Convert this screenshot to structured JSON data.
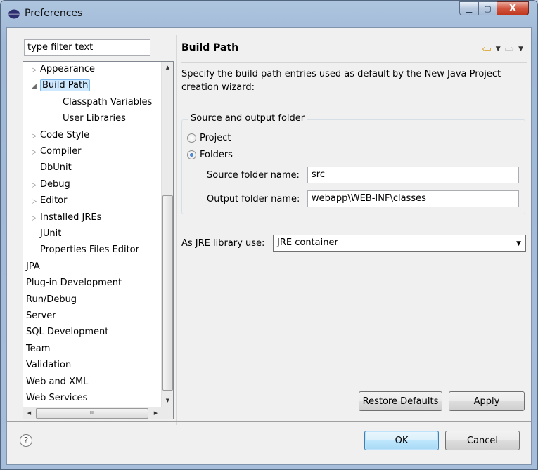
{
  "window": {
    "title": "Preferences",
    "controls": {
      "minimize": "▁",
      "maximize": "▢",
      "close": "X"
    }
  },
  "left": {
    "filter_placeholder": "type filter text",
    "tree": [
      {
        "label": "Appearance",
        "expander": "▷",
        "indent": 1
      },
      {
        "label": "Build Path",
        "expander": "◢",
        "indent": 1,
        "selected": true
      },
      {
        "label": "Classpath Variables",
        "expander": "",
        "indent": 2
      },
      {
        "label": "User Libraries",
        "expander": "",
        "indent": 2
      },
      {
        "label": "Code Style",
        "expander": "▷",
        "indent": 1
      },
      {
        "label": "Compiler",
        "expander": "▷",
        "indent": 1
      },
      {
        "label": "DbUnit",
        "expander": "",
        "indent": 1
      },
      {
        "label": "Debug",
        "expander": "▷",
        "indent": 1
      },
      {
        "label": "Editor",
        "expander": "▷",
        "indent": 1
      },
      {
        "label": "Installed JREs",
        "expander": "▷",
        "indent": 1
      },
      {
        "label": "JUnit",
        "expander": "",
        "indent": 1
      },
      {
        "label": "Properties Files Editor",
        "expander": "",
        "indent": 1
      },
      {
        "label": "JPA",
        "expander": "",
        "indent": 0
      },
      {
        "label": "Plug-in Development",
        "expander": "",
        "indent": 0
      },
      {
        "label": "Run/Debug",
        "expander": "",
        "indent": 0
      },
      {
        "label": "Server",
        "expander": "",
        "indent": 0
      },
      {
        "label": "SQL Development",
        "expander": "",
        "indent": 0
      },
      {
        "label": "Team",
        "expander": "",
        "indent": 0
      },
      {
        "label": "Validation",
        "expander": "",
        "indent": 0
      },
      {
        "label": "Web and XML",
        "expander": "",
        "indent": 0
      },
      {
        "label": "Web Services",
        "expander": "",
        "indent": 0
      }
    ],
    "hscroll_grip": "III"
  },
  "right": {
    "title": "Build Path",
    "nav": {
      "back": "⇦",
      "back_menu": "▼",
      "forward": "⇨",
      "forward_menu": "▼"
    },
    "description": "Specify the build path entries used as default by the New Java Project creation wizard:",
    "group_title": "Source and output folder",
    "radio_project": "Project",
    "radio_folders": "Folders",
    "source_label": "Source folder name:",
    "source_value": "src",
    "output_label": "Output folder name:",
    "output_value": "webapp\\WEB-INF\\classes",
    "jre_label": "As JRE library use:",
    "jre_value": "JRE container",
    "restore_defaults": "Restore Defaults",
    "apply": "Apply"
  },
  "footer": {
    "help": "?",
    "ok": "OK",
    "cancel": "Cancel"
  }
}
